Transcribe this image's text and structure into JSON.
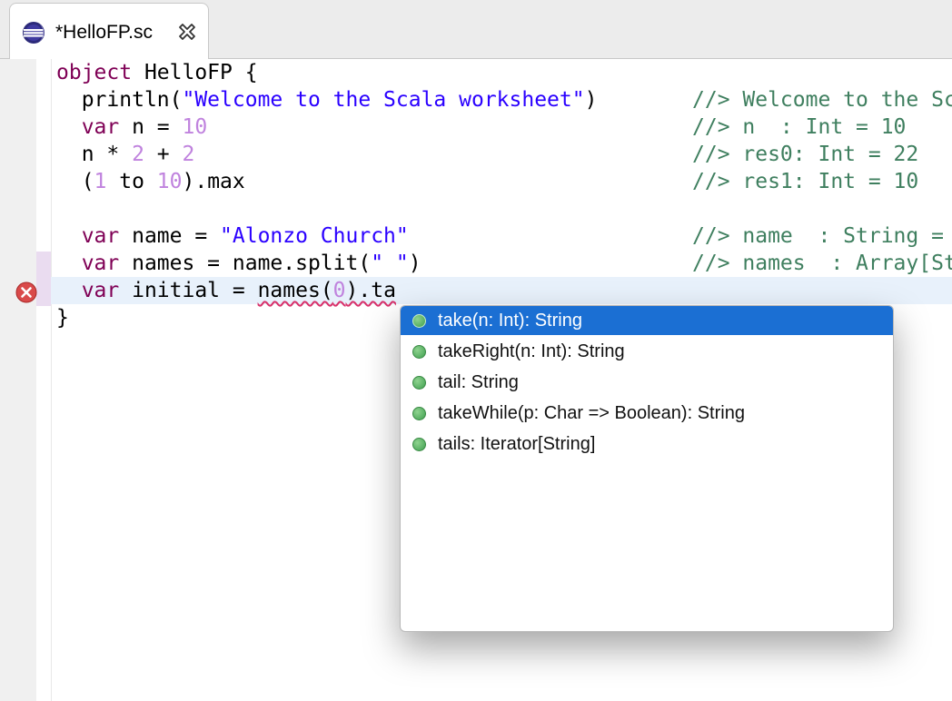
{
  "tab": {
    "title": "*HelloFP.sc"
  },
  "code": {
    "l1": {
      "kw": "object",
      "rest": " HelloFP {"
    },
    "l2": {
      "indent": "  ",
      "fn": "println(",
      "str": "\"Welcome to the Scala worksheet\"",
      "close": ")",
      "result": "//> Welcome to the Sc"
    },
    "l3": {
      "kw": "  var",
      "mid": " n = ",
      "num": "10",
      "result": "//> n  : Int = 10"
    },
    "l4": {
      "a": "  n * ",
      "n1": "2",
      "b": " + ",
      "n2": "2",
      "result": "//> res0: Int = 22"
    },
    "l5": {
      "a": "  (",
      "n1": "1",
      "b": " to ",
      "n2": "10",
      "c": ").max",
      "result": "//> res1: Int = 10"
    },
    "l6": {
      "kw": "  var",
      "mid": " name = ",
      "str": "\"Alonzo Church\"",
      "result": "//> name  : String ="
    },
    "l7": {
      "kw": "  var",
      "mid": " names = name.split(",
      "str": "\" \"",
      "close": ")",
      "result": "//> names  : Array[St"
    },
    "l8": {
      "kw": "  var",
      "mid": " initial = ",
      "sq1": "names(",
      "sqnum": "0",
      "sq2": ").ta"
    },
    "l9": {
      "text": "}"
    }
  },
  "assist": {
    "items": [
      {
        "label": "take(n: Int): String",
        "selected": true
      },
      {
        "label": "takeRight(n: Int): String"
      },
      {
        "label": "tail: String"
      },
      {
        "label": "takeWhile(p: Char => Boolean): String"
      },
      {
        "label": "tails: Iterator[String]"
      }
    ]
  },
  "colors": {
    "keyword": "#7f0055",
    "string": "#2a00ff",
    "number": "#c083de",
    "comment": "#3f7f5f",
    "selection": "#1b6fd3",
    "error": "#d8306a"
  }
}
